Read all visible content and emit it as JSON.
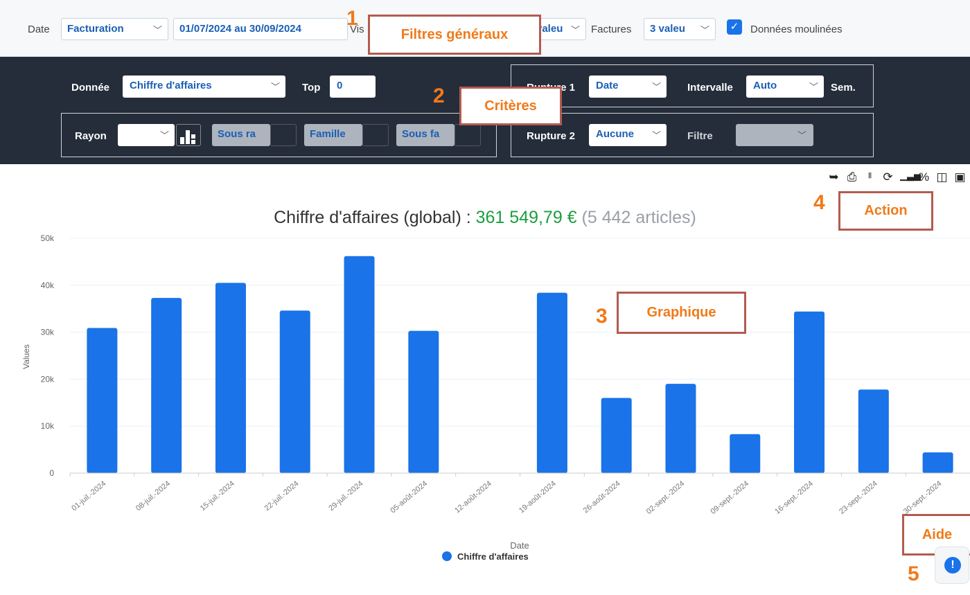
{
  "filters": {
    "date_label": "Date",
    "date_type": "Facturation",
    "date_range": "01/07/2024 au 30/09/2024",
    "vis_label": "Vis",
    "vis_value": "valeu",
    "factures_label": "Factures",
    "factures_value": "3 valeu",
    "donnees_moulinees_label": "Données moulinées",
    "donnees_moulinees_checked": true
  },
  "criteria": {
    "donnee_label": "Donnée",
    "donnee_value": "Chiffre d'affaires",
    "top_label": "Top",
    "top_value": "0",
    "rupture1_label": "Rupture 1",
    "rupture1_value": "Date",
    "intervalle_label": "Intervalle",
    "intervalle_value": "Auto",
    "sem_label": "Sem.",
    "rayon_label": "Rayon",
    "rayon_value": "",
    "sous_rayon_value": "Sous ra",
    "famille_value": "Famille",
    "sous_famille_value": "Sous fa",
    "rupture2_label": "Rupture 2",
    "rupture2_value": "Aucune",
    "filtre_label": "Filtre",
    "filtre_value": ""
  },
  "toolbar": {
    "icons": [
      "export-icon",
      "print-icon",
      "price-tag-icon",
      "refresh-icon",
      "bar-chart-icon",
      "percent-icon",
      "columns-icon",
      "save-icon"
    ]
  },
  "chart_title": {
    "prefix": "Chiffre d'affaires (global) : ",
    "amount": "361 549,79 €",
    "suffix": " (5 442 articles)"
  },
  "chart_data": {
    "type": "bar",
    "categories": [
      "01-juil.-2024",
      "08-juil.-2024",
      "15-juil.-2024",
      "22-juil.-2024",
      "29-juil.-2024",
      "05-août-2024",
      "12-août-2024",
      "19-août-2024",
      "26-août-2024",
      "02-sept.-2024",
      "09-sept.-2024",
      "16-sept.-2024",
      "23-sept.-2024",
      "30-sept.-2024"
    ],
    "series": [
      {
        "name": "Chiffre d'affaires",
        "values": [
          30900,
          37300,
          40500,
          34600,
          46200,
          30300,
          0,
          38400,
          16000,
          19000,
          8300,
          34400,
          17800,
          4400
        ]
      }
    ],
    "xlabel": "Date",
    "ylabel": "Values",
    "ylim": [
      0,
      50000
    ],
    "yticks": [
      "0",
      "10k",
      "20k",
      "30k",
      "40k",
      "50k"
    ],
    "grid": true,
    "legend": "bottom-center",
    "color": "#1a73e8"
  },
  "annotations": [
    {
      "num": "1",
      "label": "Filtres généraux"
    },
    {
      "num": "2",
      "label": "Critères"
    },
    {
      "num": "3",
      "label": "Graphique"
    },
    {
      "num": "4",
      "label": "Action"
    },
    {
      "num": "5",
      "label": "Aide"
    }
  ],
  "colors": {
    "accent": "#1a73e8",
    "panel": "#252d3a",
    "callout_text": "#f07a1a",
    "callout_border": "#b35b4f",
    "total_green": "#1a9e3e"
  }
}
